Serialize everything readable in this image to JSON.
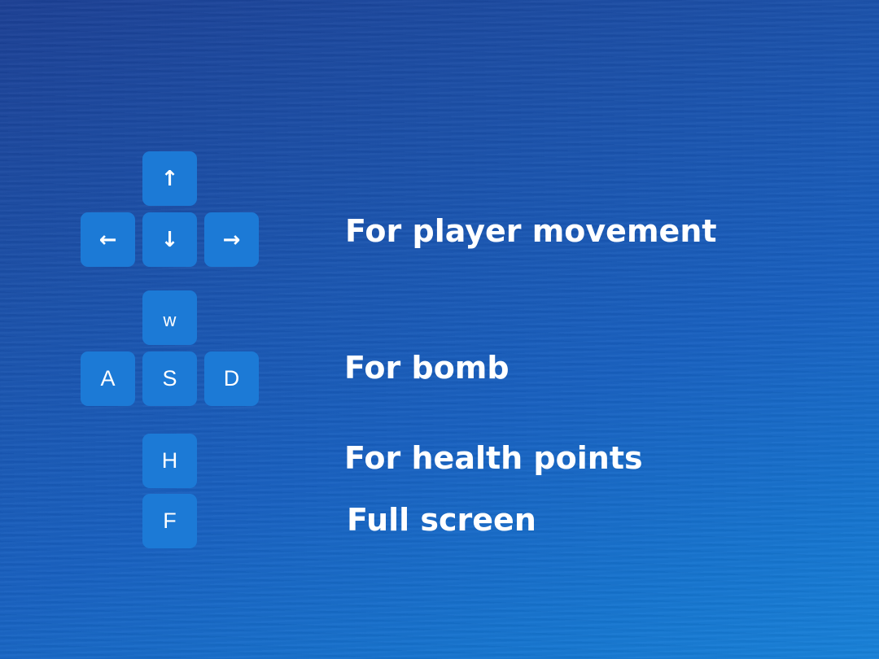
{
  "movement": {
    "keys": {
      "up": "↑",
      "left": "←",
      "down": "↓",
      "right": "→"
    },
    "description": "For player movement"
  },
  "bomb": {
    "keys": {
      "w": "w",
      "a": "A",
      "s": "S",
      "d": "D"
    },
    "description": "For bomb"
  },
  "health": {
    "key": "H",
    "description": "For health points"
  },
  "fullscreen": {
    "key": "F",
    "description": "Full screen"
  },
  "colors": {
    "key_fill": "#1c7ad6",
    "text": "#ffffff",
    "background_start": "#1b3f94",
    "background_end": "#1680d8"
  }
}
